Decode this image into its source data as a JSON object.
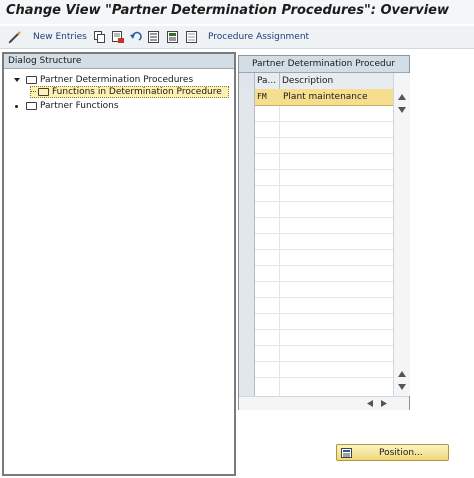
{
  "window": {
    "title": "Change View \"Partner Determination Procedures\": Overview"
  },
  "toolbar": {
    "new_entries_label": "New Entries",
    "procedure_assignment_label": "Procedure Assignment"
  },
  "dialog_structure": {
    "header": "Dialog Structure",
    "nodes": [
      {
        "label": "Partner Determination Procedures"
      },
      {
        "label": "Functions in Determination Procedure"
      },
      {
        "label": "Partner Functions"
      }
    ]
  },
  "table": {
    "title": "Partner Determination Procedur",
    "columns": [
      "Pa...",
      "Description"
    ],
    "rows": [
      {
        "code": "FM",
        "description": "Plant maintenance"
      }
    ]
  },
  "position_button": {
    "label": "Position..."
  },
  "colors": {
    "selection": "#f5df8f",
    "highlight": "#fdf0b0",
    "header": "#d3dde6"
  }
}
